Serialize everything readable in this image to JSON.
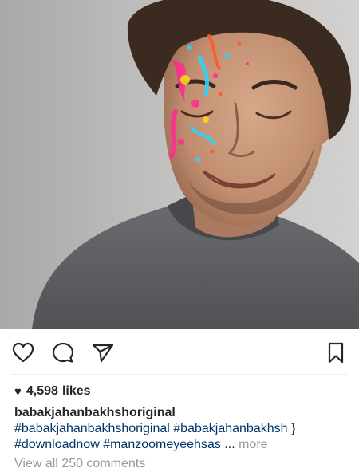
{
  "post": {
    "image": {
      "alt": "Smiling man with splashes of colored powder paint on his face",
      "colors": {
        "wall": "#bdbcba",
        "shirt": "#5d5f63",
        "skin": "#c8997c",
        "hair": "#3b2a20",
        "paint_accents": [
          "#ff2f8f",
          "#2bd4ff",
          "#ffd21f",
          "#ff5a2a"
        ]
      }
    },
    "actions": {
      "like_icon": "heart-outline-icon",
      "comment_icon": "speech-bubble-icon",
      "share_icon": "paper-plane-icon",
      "bookmark_icon": "bookmark-outline-icon"
    },
    "likes": {
      "glyph": "♥",
      "count": "4,598",
      "label": "likes"
    },
    "caption": {
      "username": "babakjahanbakhshoriginal",
      "line1_tags": [
        "#babakjahanbakhshoriginal",
        "#babakjahanbakhsh"
      ],
      "line1_suffix": "}",
      "line2_tags": [
        "#downloadnow",
        "#manzoomeyeehsas"
      ],
      "ellipsis": "...",
      "more_label": "more"
    },
    "comments_link": "View all 250 comments"
  },
  "colors": {
    "text": "#262626",
    "hashtag": "#003569",
    "muted": "#999999",
    "divider": "#efefef"
  }
}
